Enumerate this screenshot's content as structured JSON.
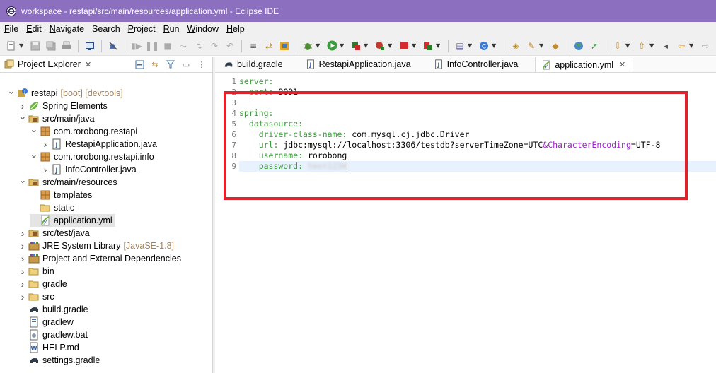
{
  "window": {
    "title": "workspace - restapi/src/main/resources/application.yml - Eclipse IDE"
  },
  "menu": {
    "items": [
      {
        "first": "F",
        "rest": "ile"
      },
      {
        "first": "E",
        "rest": "dit"
      },
      {
        "first": "N",
        "rest": "avigate"
      },
      {
        "first": "",
        "rest": "Search"
      },
      {
        "first": "P",
        "rest": "roject"
      },
      {
        "first": "R",
        "rest": "un"
      },
      {
        "first": "W",
        "rest": "indow"
      },
      {
        "first": "H",
        "rest": "elp"
      }
    ]
  },
  "explorer": {
    "title": "Project Explorer",
    "tree": [
      {
        "label": "restapi",
        "decoration": "[boot] [devtools]",
        "icon": "project-icon",
        "twisty": "v"
      },
      {
        "label": "Spring Elements",
        "icon": "spring-leaf-icon",
        "twisty": ">"
      },
      {
        "label": "src/main/java",
        "icon": "source-folder-icon",
        "twisty": "v"
      },
      {
        "label": "com.rorobong.restapi",
        "icon": "package-icon",
        "twisty": "v"
      },
      {
        "label": "RestapiApplication.java",
        "icon": "java-file-icon",
        "twisty": ">"
      },
      {
        "label": "com.rorobong.restapi.info",
        "icon": "package-icon",
        "twisty": "v"
      },
      {
        "label": "InfoController.java",
        "icon": "java-file-icon",
        "twisty": ">"
      },
      {
        "label": "src/main/resources",
        "icon": "source-folder-icon",
        "twisty": "v"
      },
      {
        "label": "templates",
        "icon": "package-icon",
        "twisty": ""
      },
      {
        "label": "static",
        "icon": "folder-icon",
        "twisty": ""
      },
      {
        "label": "application.yml",
        "icon": "yaml-file-icon",
        "twisty": ""
      },
      {
        "label": "src/test/java",
        "icon": "source-folder-icon",
        "twisty": ">"
      },
      {
        "label": "JRE System Library",
        "decoration": "[JavaSE-1.8]",
        "icon": "library-icon",
        "twisty": ">"
      },
      {
        "label": "Project and External Dependencies",
        "icon": "library-icon",
        "twisty": ">"
      },
      {
        "label": "bin",
        "icon": "folder-icon",
        "twisty": ">"
      },
      {
        "label": "gradle",
        "icon": "folder-icon",
        "twisty": ">"
      },
      {
        "label": "src",
        "icon": "folder-icon",
        "twisty": ">"
      },
      {
        "label": "build.gradle",
        "icon": "gradle-icon",
        "twisty": ""
      },
      {
        "label": "gradlew",
        "icon": "text-file-icon",
        "twisty": ""
      },
      {
        "label": "gradlew.bat",
        "icon": "bat-file-icon",
        "twisty": ""
      },
      {
        "label": "HELP.md",
        "icon": "md-file-icon",
        "twisty": ""
      },
      {
        "label": "settings.gradle",
        "icon": "gradle-icon",
        "twisty": ""
      }
    ]
  },
  "editor": {
    "tabs": [
      {
        "label": "build.gradle",
        "icon": "gradle-icon",
        "active": false
      },
      {
        "label": "RestapiApplication.java",
        "icon": "java-file-icon",
        "active": false
      },
      {
        "label": "InfoController.java",
        "icon": "java-file-icon",
        "active": false
      },
      {
        "label": "application.yml",
        "icon": "yaml-file-icon",
        "active": true
      }
    ],
    "line_numbers": [
      "1",
      "2",
      "3",
      "4",
      "5",
      "6",
      "7",
      "8",
      "9"
    ],
    "lines": [
      {
        "key": "server:",
        "val": ""
      },
      {
        "key": "  port:",
        "val": " 9091"
      },
      {
        "key": "",
        "val": ""
      },
      {
        "key": "spring:",
        "val": ""
      },
      {
        "key": "  datasource:",
        "val": ""
      },
      {
        "key": "    driver-class-name:",
        "val": " com.mysql.cj.jdbc.Driver"
      },
      {
        "key": "    url:",
        "val": " jdbc:mysql://localhost:3306/testdb?serverTimeZone=UTC",
        "amp": "&CharacterEncoding",
        "tail": "=UTF-8"
      },
      {
        "key": "    username:",
        "val": " rorobong"
      },
      {
        "key": "    password:",
        "val": " ",
        "blurred": "test1234"
      }
    ]
  },
  "colors": {
    "titlebar": "#8d6fc0",
    "highlight_box": "#e3212b",
    "yaml_key": "#3a9a3a"
  }
}
